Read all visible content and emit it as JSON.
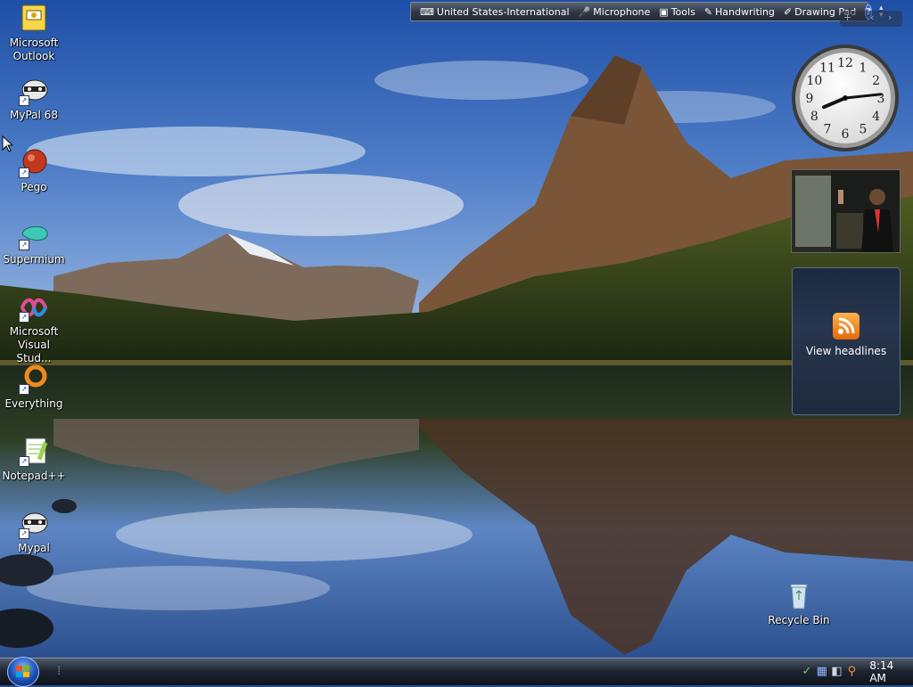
{
  "desktop": {
    "icons": [
      {
        "label": "Microsoft\nOutlook",
        "icon": "outlook-icon"
      },
      {
        "label": "MyPal 68",
        "icon": "raccoon-icon"
      },
      {
        "label": "Pego",
        "icon": "pego-icon"
      },
      {
        "label": "Supermium",
        "icon": "supermium-icon"
      },
      {
        "label": "Microsoft\nVisual Stud...",
        "icon": "visual-studio-icon"
      },
      {
        "label": "Everything",
        "icon": "everything-icon"
      },
      {
        "label": "Notepad++",
        "icon": "notepadpp-icon"
      },
      {
        "label": "Mypal",
        "icon": "raccoon-icon"
      }
    ],
    "recycle_bin": {
      "label": "Recycle Bin",
      "icon": "recycle-bin-icon"
    }
  },
  "language_bar": {
    "items": [
      {
        "label": "United States-International",
        "icon": "keyboard-icon"
      },
      {
        "label": "Microphone",
        "icon": "microphone-icon"
      },
      {
        "label": "Tools",
        "icon": "tools-icon"
      },
      {
        "label": "Handwriting",
        "icon": "pen-icon"
      },
      {
        "label": "Drawing Pad",
        "icon": "drawing-pad-icon"
      }
    ],
    "help_label": "?"
  },
  "sidebar": {
    "clock": {
      "hour": 8,
      "minute": 14
    },
    "feed_label": "View headlines"
  },
  "taskbar": {
    "time": "8:14 AM"
  },
  "colors": {
    "taskbar": "#1f2632",
    "accent": "#2b63d9",
    "rss": "#f28b1c"
  }
}
